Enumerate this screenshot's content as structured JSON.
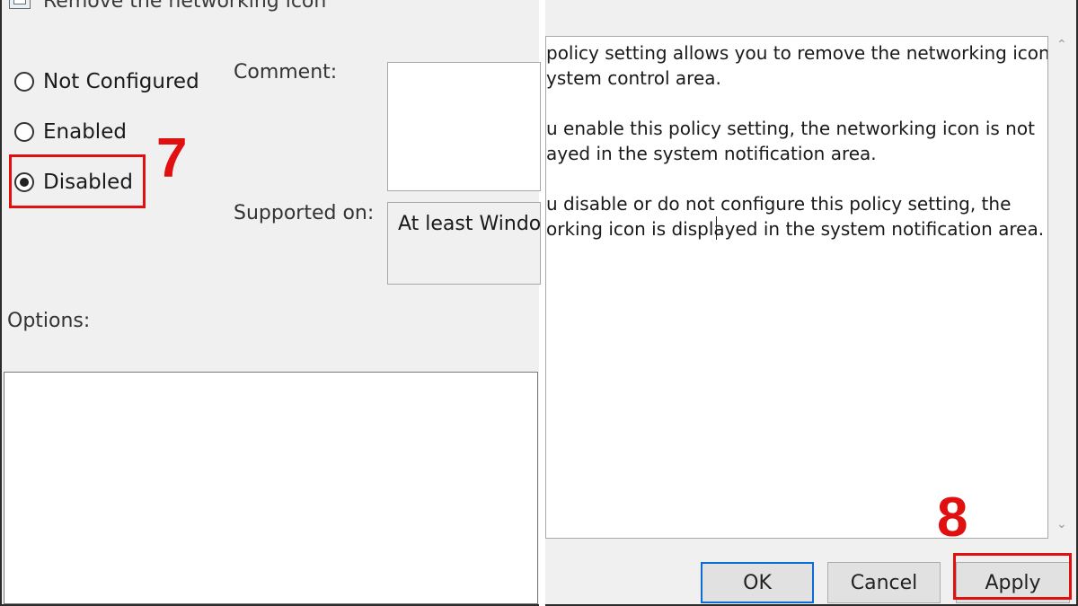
{
  "title": "Remove the networking icon",
  "states": {
    "not_configured": "Not Configured",
    "enabled": "Enabled",
    "disabled": "Disabled",
    "selected": "disabled"
  },
  "fields": {
    "comment_label": "Comment:",
    "supported_label": "Supported on:",
    "supported_value": "At least Windov",
    "options_label": "Options:"
  },
  "help": {
    "lines": [
      "policy setting allows you to remove the networking icon from",
      "ystem control area.",
      "u enable this policy setting, the networking icon is not",
      "ayed in the system notification area.",
      "u disable or do not configure this policy setting, the",
      "orking icon is displayed in the system notification area."
    ]
  },
  "buttons": {
    "ok": "OK",
    "cancel": "Cancel",
    "apply": "Apply"
  },
  "steps": {
    "step7": "7",
    "step8": "8"
  },
  "colors": {
    "annotation_red": "#e01010",
    "focus_blue": "#0a6cd6"
  }
}
